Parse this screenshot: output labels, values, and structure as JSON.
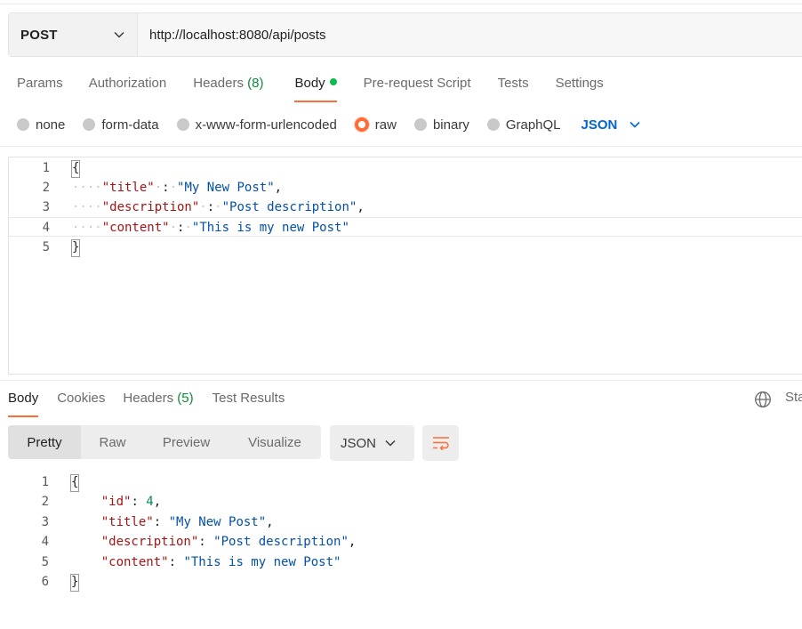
{
  "request": {
    "method": "POST",
    "url": "http://localhost:8080/api/posts"
  },
  "request_tabs": {
    "params": "Params",
    "authorization": "Authorization",
    "headers": "Headers",
    "headers_count": "(8)",
    "body": "Body",
    "prerequest": "Pre-request Script",
    "tests": "Tests",
    "settings": "Settings"
  },
  "body_types": {
    "none": "none",
    "form_data": "form-data",
    "urlencoded": "x-www-form-urlencoded",
    "raw": "raw",
    "binary": "binary",
    "graphql": "GraphQL",
    "format": "JSON",
    "selected": "raw"
  },
  "request_body": {
    "line_numbers": [
      "1",
      "2",
      "3",
      "4",
      "5"
    ],
    "open": "{",
    "close": "}",
    "title_key": "\"title\"",
    "title_val": "\"My New Post\"",
    "desc_key": "\"description\"",
    "desc_val": "\"Post description\"",
    "content_key": "\"content\"",
    "content_val": "\"This is my new Post\""
  },
  "response_tabs": {
    "body": "Body",
    "cookies": "Cookies",
    "headers": "Headers",
    "headers_count": "(5)",
    "test_results": "Test Results",
    "status_partial": "Sta"
  },
  "response_view": {
    "pretty": "Pretty",
    "raw": "Raw",
    "preview": "Preview",
    "visualize": "Visualize",
    "format": "JSON"
  },
  "response_body": {
    "line_numbers": [
      "1",
      "2",
      "3",
      "4",
      "5",
      "6"
    ],
    "open": "{",
    "close": "}",
    "id_key": "\"id\"",
    "id_val": "4",
    "title_key": "\"title\"",
    "title_val": "\"My New Post\"",
    "desc_key": "\"description\"",
    "desc_val": "\"Post description\"",
    "content_key": "\"content\"",
    "content_val": "\"This is my new Post\""
  },
  "colors": {
    "accent": "#ff6c37",
    "json_blue": "#0265d2",
    "count_green": "#0f8a3c",
    "active_dot": "#0cbb52"
  },
  "icons": {
    "method_dropdown": "chevron-down-icon",
    "format_dropdown": "chevron-down-icon",
    "globe": "globe-icon",
    "wrap": "wrap-lines-icon"
  }
}
